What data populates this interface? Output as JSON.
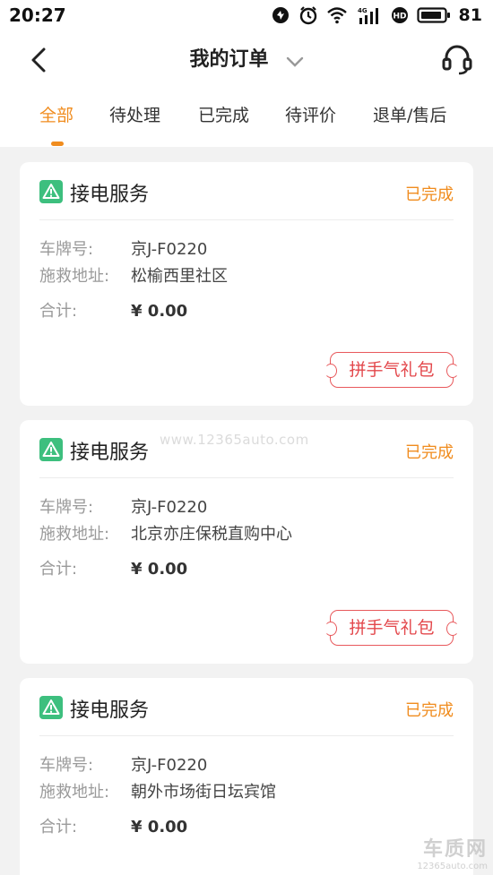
{
  "status_bar": {
    "time": "20:27",
    "battery": "81",
    "network_label": "4G",
    "icons": [
      "notification-icon",
      "alarm-icon",
      "wifi-icon",
      "signal-icon",
      "hd-icon",
      "battery-icon"
    ]
  },
  "header": {
    "title": "我的订单",
    "icons": [
      "back-icon",
      "chevron-down-icon",
      "headset-icon"
    ]
  },
  "tabs": [
    {
      "label": "全部",
      "active": true
    },
    {
      "label": "待处理",
      "active": false
    },
    {
      "label": "已完成",
      "active": false
    },
    {
      "label": "待评价",
      "active": false
    },
    {
      "label": "退单/售后",
      "active": false
    }
  ],
  "labels": {
    "plate": "车牌号:",
    "address": "施救地址:",
    "total": "合计:"
  },
  "orders": [
    {
      "service": "接电服务",
      "status": "已完成",
      "plate": "京J-F0220",
      "address": "松榆西里社区",
      "total": "¥ 0.00",
      "button": "拼手气礼包"
    },
    {
      "service": "接电服务",
      "status": "已完成",
      "plate": "京J-F0220",
      "address": "北京亦庄保税直购中心",
      "total": "¥ 0.00",
      "button": "拼手气礼包"
    },
    {
      "service": "接电服务",
      "status": "已完成",
      "plate": "京J-F0220",
      "address": "朝外市场街日坛宾馆",
      "total": "¥ 0.00",
      "button": ""
    }
  ],
  "watermark": "www.12365auto.com",
  "corner_logo": {
    "title": "车质网",
    "url": "12365auto.com"
  },
  "colors": {
    "accent": "#f08c1e",
    "service_icon": "#3dbf7e",
    "gift_red": "#e3474b",
    "background": "#f2f2f2"
  }
}
